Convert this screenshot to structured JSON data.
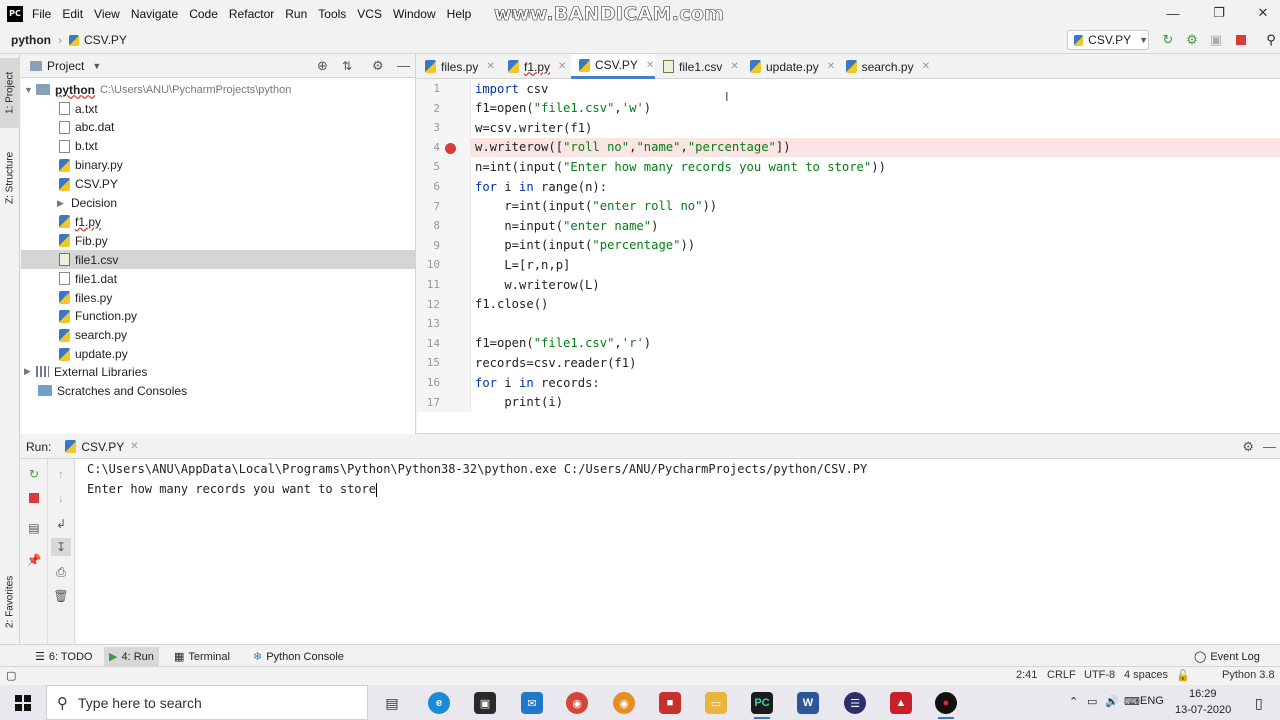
{
  "menubar": {
    "items": [
      "File",
      "Edit",
      "View",
      "Navigate",
      "Code",
      "Refactor",
      "Run",
      "Tools",
      "VCS",
      "Window",
      "Help"
    ],
    "project_title": "python -",
    "watermark": "www.BANDICAM.com",
    "logo": "PC"
  },
  "navbar": {
    "crumbs": [
      "python",
      "CSV.PY"
    ],
    "run_config": "CSV.PY"
  },
  "left_stripe": {
    "project_tab": "1: Project",
    "structure_tab": "Z: Structure",
    "favorites_tab": "2: Favorites"
  },
  "project_panel": {
    "title": "Project",
    "root": {
      "name": "python",
      "path": "C:\\Users\\ANU\\PycharmProjects\\python"
    },
    "files": [
      {
        "name": "a.txt",
        "kind": "text"
      },
      {
        "name": "abc.dat",
        "kind": "text"
      },
      {
        "name": "b.txt",
        "kind": "text"
      },
      {
        "name": "binary.py",
        "kind": "py"
      },
      {
        "name": "CSV.PY",
        "kind": "py"
      },
      {
        "name": "Decision",
        "kind": "folder"
      },
      {
        "name": "f1.py",
        "kind": "py"
      },
      {
        "name": "Fib.py",
        "kind": "py"
      },
      {
        "name": "file1.csv",
        "kind": "csv"
      },
      {
        "name": "file1.dat",
        "kind": "text"
      },
      {
        "name": "files.py",
        "kind": "py"
      },
      {
        "name": "Function.py",
        "kind": "py"
      },
      {
        "name": "search.py",
        "kind": "py"
      },
      {
        "name": "update.py",
        "kind": "py"
      }
    ],
    "selected": "file1.csv",
    "external_libraries": "External Libraries",
    "scratches": "Scratches and Consoles"
  },
  "editor": {
    "tabs": [
      "files.py",
      "f1.py",
      "CSV.PY",
      "file1.csv",
      "update.py",
      "search.py"
    ],
    "active_tab": "CSV.PY",
    "line_numbers": [
      "1",
      "2",
      "3",
      "4",
      "5",
      "6",
      "7",
      "8",
      "9",
      "10",
      "11",
      "12",
      "13",
      "14",
      "15",
      "16",
      "17"
    ],
    "breakpoint_line": 4
  },
  "run_panel": {
    "label": "Run:",
    "tab": "CSV.PY",
    "console": [
      "C:\\Users\\ANU\\AppData\\Local\\Programs\\Python\\Python38-32\\python.exe C:/Users/ANU/PycharmProjects/python/CSV.PY",
      "Enter how many records you want to store"
    ]
  },
  "bottom_tabs": {
    "todo": "6: TODO",
    "run": "4: Run",
    "terminal": "Terminal",
    "python_console": "Python Console",
    "event_log": "Event Log"
  },
  "statusbar": {
    "position": "2:41",
    "line_sep": "CRLF",
    "encoding": "UTF-8",
    "indent": "4 spaces",
    "interpreter": "Python 3.8"
  },
  "taskbar": {
    "search_placeholder": "Type here to search",
    "language": "ENG",
    "time": "16:29",
    "date": "13-07-2020"
  },
  "colors": {
    "keyword": "#0033b3",
    "string": "#067d17",
    "breakpoint": "#db3a3a",
    "active_tab_underline": "#4083c9"
  }
}
